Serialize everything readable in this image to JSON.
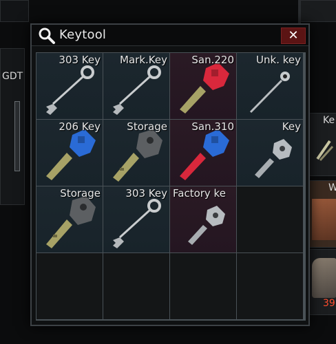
{
  "window": {
    "title": "Keytool",
    "close_symbol": "✕",
    "search_icon": "magnifier-icon"
  },
  "background": {
    "left_label": "GDT",
    "right_top_label": "Ke",
    "right_mid_label": "W",
    "right_bottom_value": "39"
  },
  "slots": [
    {
      "label": "303 Key",
      "style": "skeleton",
      "bg": "item"
    },
    {
      "label": "Mark.Key",
      "style": "skeleton",
      "bg": "item"
    },
    {
      "label": "San.220",
      "style": "red",
      "bg": "red"
    },
    {
      "label": "Unk. key",
      "style": "thin",
      "bg": "item"
    },
    {
      "label": "206 Key",
      "style": "blue",
      "bg": "item"
    },
    {
      "label": "Storage",
      "style": "grey",
      "bg": "item"
    },
    {
      "label": "San.310",
      "style": "blue-red",
      "bg": "red"
    },
    {
      "label": "Key",
      "style": "silver",
      "bg": "item"
    },
    {
      "label": "Storage",
      "style": "grey",
      "bg": "item"
    },
    {
      "label": "303 Key",
      "style": "skeleton",
      "bg": "item"
    },
    {
      "label": "Factory ke",
      "style": "silver-small",
      "bg": "red"
    },
    {
      "label": "",
      "style": "none",
      "bg": "empty"
    },
    {
      "label": "",
      "style": "none",
      "bg": "empty"
    },
    {
      "label": "",
      "style": "none",
      "bg": "empty"
    },
    {
      "label": "",
      "style": "none",
      "bg": "empty"
    },
    {
      "label": "",
      "style": "none",
      "bg": "empty"
    }
  ],
  "colors": {
    "close_bg": "#5b1414",
    "grid_line": "#4a5257",
    "red_key": "#d9283c",
    "blue_key": "#2a6bd6",
    "brass_blade": "#a7a266",
    "grey_key": "#5c5f62",
    "silver_key": "#b7bcc0"
  }
}
